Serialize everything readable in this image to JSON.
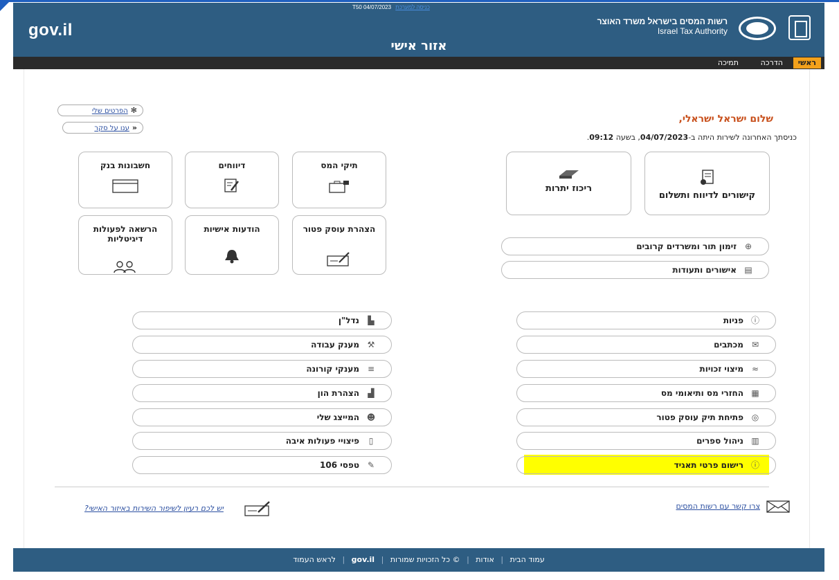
{
  "header": {
    "logo_text": "gov.il",
    "stamp_code": "T50 04/07/2023",
    "stamp_link": "כניסה למערכת",
    "authority_he": "רשות המסים בישראל משרד האוצר",
    "authority_en": "Israel Tax Authority",
    "page_title": "אזור אישי"
  },
  "nav": {
    "main": "ראשי",
    "guide": "הדרכה",
    "support": "תמיכה"
  },
  "links": {
    "my_details": "הפרטים שלי",
    "survey": "ענו על סקר"
  },
  "greeting": "שלום ישראל ישראלי,",
  "last_login": {
    "prefix": "כניסתך האחרונה לשירות היתה ב-",
    "date": "04/07/2023",
    "mid": ", בשעה ",
    "time": "09:12",
    "end": "."
  },
  "tiles_right": [
    {
      "label": "קישורים לדיווח ותשלום"
    },
    {
      "label": "ריכוז יתרות"
    }
  ],
  "tiles_left_row1": [
    {
      "label": "תיקי המס"
    },
    {
      "label": "דיווחים"
    },
    {
      "label": "חשבונות בנק"
    }
  ],
  "tiles_left_row2": [
    {
      "label": "הצהרת עוסק פטור"
    },
    {
      "label": "הודעות אישיות"
    },
    {
      "label": "הרשאה לפעולות דיגיטליות"
    }
  ],
  "quick_pills": [
    {
      "label": "זימון תור ומשרדים קרובים"
    },
    {
      "label": "אישורים ותעודות"
    }
  ],
  "list_right": [
    {
      "label": "פניות"
    },
    {
      "label": "מכתבים"
    },
    {
      "label": "מיצוי זכויות"
    },
    {
      "label": "החזרי מס ותיאומי מס"
    },
    {
      "label": "פתיחת תיק עוסק פטור"
    },
    {
      "label": "ניהול ספרים"
    },
    {
      "label": "רישום פרטי תאגיד"
    }
  ],
  "list_left": [
    {
      "label": "נדל\"ן"
    },
    {
      "label": "מענק עבודה"
    },
    {
      "label": "מענקי קורונה"
    },
    {
      "label": "הצהרת הון"
    },
    {
      "label": "המייצג שלי"
    },
    {
      "label": "פיצויי פעולות איבה"
    },
    {
      "label": "טפסי 106"
    }
  ],
  "bottom": {
    "contact": "צרו קשר עם רשות המסים",
    "idea": "יש לכם רעיון לשיפור השירות באיזור האישי?"
  },
  "footer": {
    "home": "עמוד הבית",
    "about": "אודות",
    "rights": "© כל הזכויות שמורות",
    "govil": "gov.il",
    "top": "לראש העמוד"
  },
  "colors": {
    "header_bg": "#2e5d82",
    "nav_bg": "#2a2a2a",
    "nav_active": "#f3a11b",
    "greeting": "#c8501c",
    "highlight": "#ffff00",
    "link": "#2a4ea0"
  }
}
